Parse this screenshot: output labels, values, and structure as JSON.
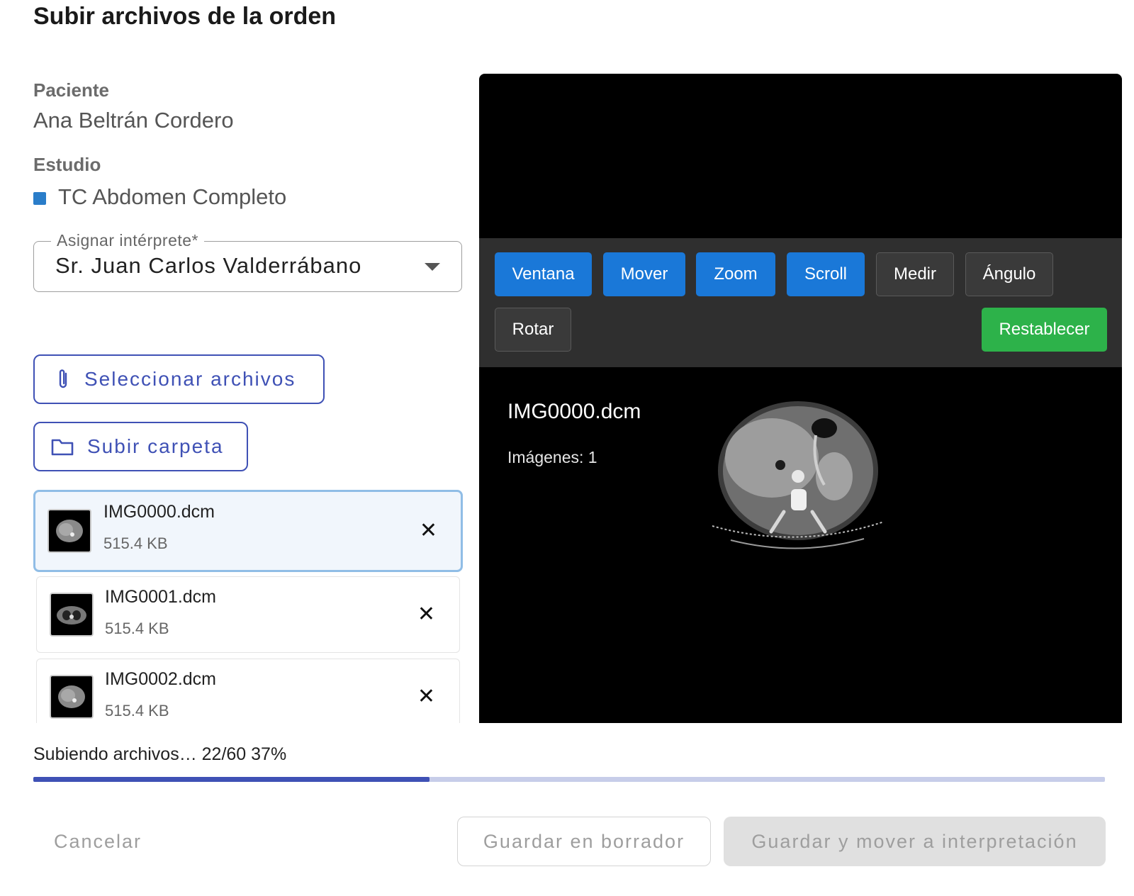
{
  "dialog": {
    "title": "Subir archivos de la orden"
  },
  "patient": {
    "label": "Paciente",
    "name": "Ana Beltrán Cordero"
  },
  "study": {
    "label": "Estudio",
    "name": "TC Abdomen Completo",
    "color": "#2a7dc9"
  },
  "interpreter": {
    "label": "Asignar intérprete*",
    "value": "Sr. Juan Carlos Valderrábano"
  },
  "actions": {
    "select_files": "Seleccionar archivos",
    "upload_folder": "Subir carpeta"
  },
  "files": [
    {
      "name": "IMG0000.dcm",
      "size": "515.4 KB",
      "remove": "✕"
    },
    {
      "name": "IMG0001.dcm",
      "size": "515.4 KB",
      "remove": "✕"
    },
    {
      "name": "IMG0002.dcm",
      "size": "515.4 KB",
      "remove": "✕"
    }
  ],
  "viewer": {
    "tools": {
      "ventana": "Ventana",
      "mover": "Mover",
      "zoom": "Zoom",
      "scroll": "Scroll",
      "medir": "Medir",
      "angulo": "Ángulo",
      "rotar": "Rotar",
      "reset": "Restablecer"
    },
    "image_name": "IMG0000.dcm",
    "image_count": "Imágenes: 1"
  },
  "progress": {
    "text": "Subiendo archivos… 22/60 37%",
    "fraction": 0.37
  },
  "footer": {
    "cancel": "Cancelar",
    "save_draft": "Guardar en borrador",
    "save_move": "Guardar y mover a interpretación"
  },
  "colors": {
    "primary": "#3f51b5",
    "tool_active": "#1a78d8",
    "reset": "#2db24a",
    "selected_border": "#90bde6"
  }
}
